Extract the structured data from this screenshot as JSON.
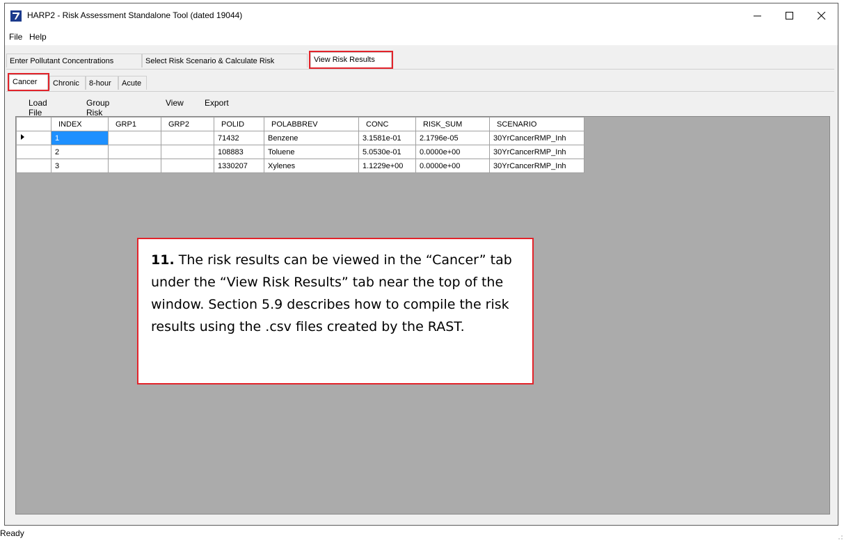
{
  "window": {
    "title": "HARP2 - Risk Assessment Standalone Tool (dated 19044)"
  },
  "menu": {
    "file": "File",
    "help": "Help"
  },
  "main_tabs": [
    {
      "label": "Enter Pollutant Concentrations"
    },
    {
      "label": "Select Risk Scenario & Calculate Risk"
    },
    {
      "label": "View Risk Results"
    }
  ],
  "sub_tabs": [
    {
      "label": "Cancer"
    },
    {
      "label": "Chronic"
    },
    {
      "label": "8-hour"
    },
    {
      "label": "Acute"
    }
  ],
  "toolbar": {
    "load_file": "Load File",
    "group_risk_by": "Group Risk By",
    "view": "View",
    "export": "Export"
  },
  "grid": {
    "columns": [
      "INDEX",
      "GRP1",
      "GRP2",
      "POLID",
      "POLABBREV",
      "CONC",
      "RISK_SUM",
      "SCENARIO"
    ],
    "rows": [
      {
        "index": "1",
        "grp1": "",
        "grp2": "",
        "polid": "71432",
        "polabbrev": "Benzene",
        "conc": "3.1581e-01",
        "risk_sum": "2.1796e-05",
        "scenario": "30YrCancerRMP_Inh"
      },
      {
        "index": "2",
        "grp1": "",
        "grp2": "",
        "polid": "108883",
        "polabbrev": "Toluene",
        "conc": "5.0530e-01",
        "risk_sum": "0.0000e+00",
        "scenario": "30YrCancerRMP_Inh"
      },
      {
        "index": "3",
        "grp1": "",
        "grp2": "",
        "polid": "1330207",
        "polabbrev": "Xylenes",
        "conc": "1.1229e+00",
        "risk_sum": "0.0000e+00",
        "scenario": "30YrCancerRMP_Inh"
      }
    ]
  },
  "callout": {
    "number": "11.",
    "text": "The risk results can be viewed in the “Cancer” tab under the “View Risk Results” tab near the top of the window.  Section 5.9 describes how to compile the risk results using the .csv files created by the RAST."
  },
  "status": {
    "text": "Ready"
  },
  "colors": {
    "highlight": "#e2232a",
    "selection": "#1e90ff",
    "grid_background": "#ababab"
  }
}
